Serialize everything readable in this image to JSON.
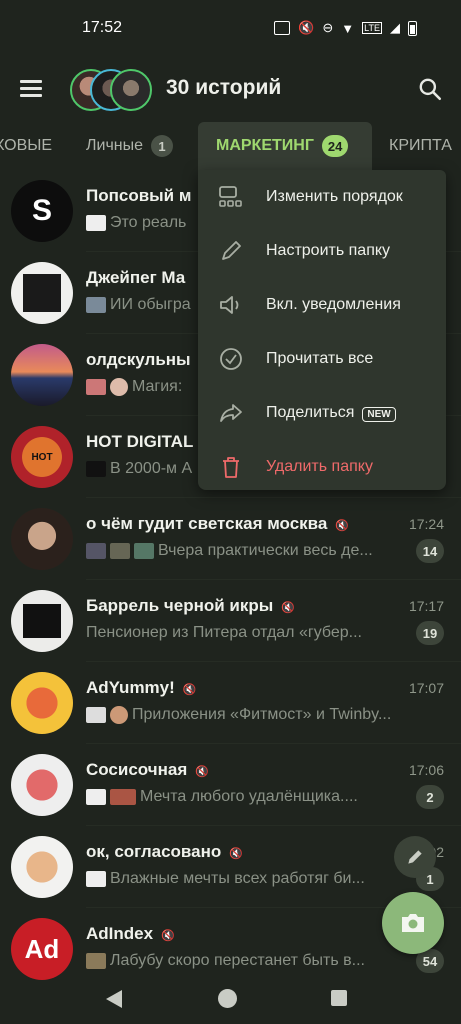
{
  "status_bar": {
    "time": "17:52"
  },
  "app_bar": {
    "title": "30 историй"
  },
  "tabs": [
    {
      "label": "ХОВЫЕ",
      "badge": ""
    },
    {
      "label": "Личные",
      "badge": "1"
    },
    {
      "label": "МАРКЕТИНГ",
      "badge": "24"
    },
    {
      "label": "КРИПТА",
      "badge": ""
    }
  ],
  "chats": [
    {
      "name": "Попсовый м",
      "time": "",
      "preview": "Это реаль",
      "unread": ""
    },
    {
      "name": "Джейпег Ма",
      "time": "",
      "preview": "ИИ обыгра",
      "unread": ""
    },
    {
      "name": "олдскульны",
      "time": "",
      "preview": "Магия:",
      "unread": ""
    },
    {
      "name": "HOT DIGITAL",
      "time": "",
      "preview": "В 2000-м А",
      "unread": ""
    },
    {
      "name": "о чём гудит светская москва",
      "time": "17:24",
      "preview": "Вчера практически весь де...",
      "unread": "14"
    },
    {
      "name": "Баррель черной икры",
      "time": "17:17",
      "preview": "Пенсионер из Питера отдал «губер...",
      "unread": "19"
    },
    {
      "name": "AdYummy!",
      "time": "17:07",
      "preview": "Приложения «Фитмост» и Twinby...",
      "unread": ""
    },
    {
      "name": "Сосисочная",
      "time": "17:06",
      "preview": "Мечта любого удалёнщика....",
      "unread": "2"
    },
    {
      "name": "ок, согласовано",
      "time": "02",
      "preview": "Влажные мечты всех работяг би...",
      "unread": "1"
    },
    {
      "name": "AdIndex",
      "time": "",
      "preview": "Лабубу скоро перестанет быть в...",
      "unread": "54"
    }
  ],
  "popup_menu": {
    "items": [
      {
        "label": "Изменить порядок",
        "icon": "reorder-icon"
      },
      {
        "label": "Настроить папку",
        "icon": "pencil-icon"
      },
      {
        "label": "Вкл. уведомления",
        "icon": "speaker-icon"
      },
      {
        "label": "Прочитать все",
        "icon": "check-circle-icon"
      },
      {
        "label": "Поделиться",
        "icon": "share-icon",
        "badge": "NEW"
      },
      {
        "label": "Удалить папку",
        "icon": "trash-icon"
      }
    ]
  },
  "colors": {
    "background": "#1f241e",
    "accent": "#9fd86f",
    "danger": "#ef6a6a",
    "fab": "#8cb87a"
  }
}
